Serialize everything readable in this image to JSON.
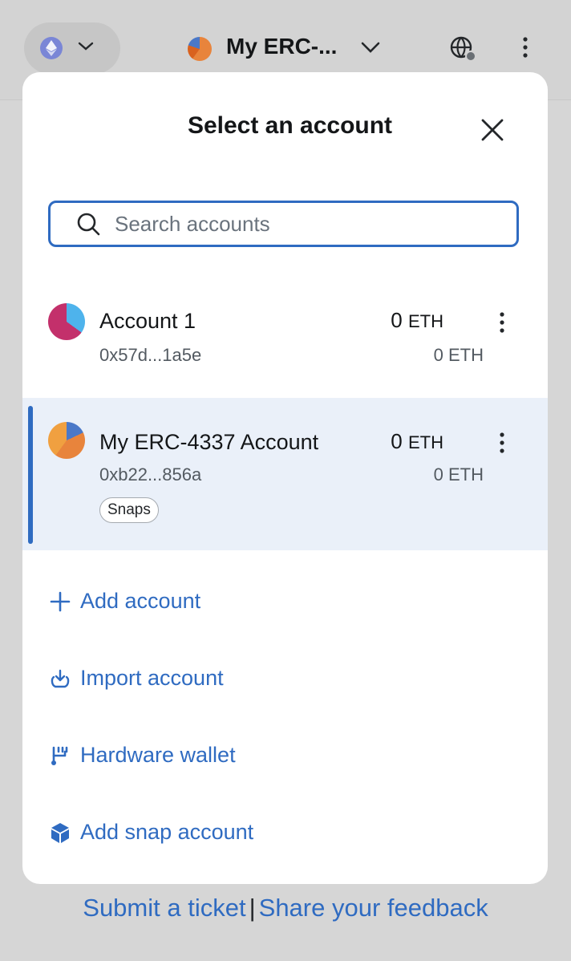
{
  "header": {
    "account_name": "My ERC-...",
    "network_icon": "ethereum-icon",
    "globe_icon": "globe-connected-icon",
    "menu_icon": "kebab-menu-icon"
  },
  "modal": {
    "title": "Select an account",
    "search_placeholder": "Search accounts",
    "accounts": [
      {
        "name": "Account 1",
        "address": "0x57d...1a5e",
        "balance": "0",
        "balance_unit": "ETH",
        "secondary_balance": "0 ETH",
        "selected": false,
        "tag": ""
      },
      {
        "name": "My ERC-4337 Account",
        "address": "0xb22...856a",
        "balance": "0",
        "balance_unit": "ETH",
        "secondary_balance": "0 ETH",
        "selected": true,
        "tag": "Snaps"
      }
    ],
    "actions": [
      {
        "label": "Add account",
        "icon": "plus-icon"
      },
      {
        "label": "Import account",
        "icon": "import-icon"
      },
      {
        "label": "Hardware wallet",
        "icon": "hardware-wallet-icon"
      },
      {
        "label": "Add snap account",
        "icon": "snap-cube-icon"
      }
    ]
  },
  "footer": {
    "submit_ticket": "Submit a ticket",
    "separator": "|",
    "share_feedback": "Share your feedback"
  },
  "colors": {
    "accent": "#2f6bc1",
    "selected_row_bg": "#eaf0f9",
    "backdrop": "#d6d6d6"
  }
}
